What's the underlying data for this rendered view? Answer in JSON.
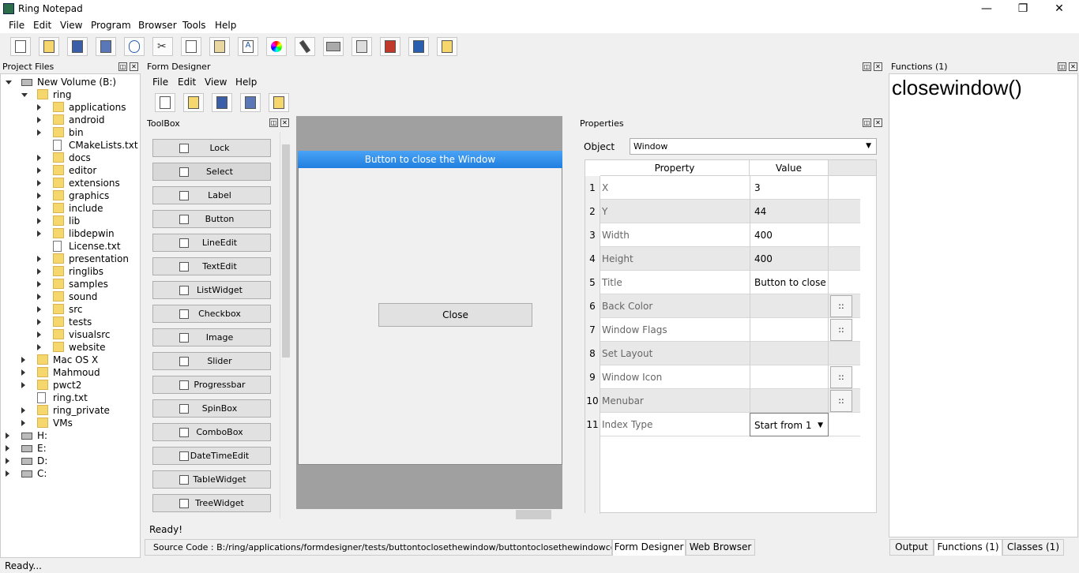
{
  "window": {
    "title": "Ring Notepad",
    "minimize": "—",
    "maximize": "❐",
    "close": "✕"
  },
  "menu": [
    "File",
    "Edit",
    "View",
    "Program",
    "Browser",
    "Tools",
    "Help"
  ],
  "project_files": {
    "title": "Project Files",
    "tree": [
      {
        "label": "New Volume (B:)",
        "kind": "drive",
        "level": 0,
        "expanded": true
      },
      {
        "label": "ring",
        "kind": "folder",
        "level": 1,
        "expanded": true
      },
      {
        "label": "applications",
        "kind": "folder",
        "level": 2
      },
      {
        "label": "android",
        "kind": "folder",
        "level": 2
      },
      {
        "label": "bin",
        "kind": "folder",
        "level": 2
      },
      {
        "label": "CMakeLists.txt",
        "kind": "file",
        "level": 2
      },
      {
        "label": "docs",
        "kind": "folder",
        "level": 2
      },
      {
        "label": "editor",
        "kind": "folder",
        "level": 2
      },
      {
        "label": "extensions",
        "kind": "folder",
        "level": 2
      },
      {
        "label": "graphics",
        "kind": "folder",
        "level": 2
      },
      {
        "label": "include",
        "kind": "folder",
        "level": 2
      },
      {
        "label": "lib",
        "kind": "folder",
        "level": 2
      },
      {
        "label": "libdepwin",
        "kind": "folder",
        "level": 2
      },
      {
        "label": "License.txt",
        "kind": "file",
        "level": 2
      },
      {
        "label": "presentation",
        "kind": "folder",
        "level": 2
      },
      {
        "label": "ringlibs",
        "kind": "folder",
        "level": 2
      },
      {
        "label": "samples",
        "kind": "folder",
        "level": 2
      },
      {
        "label": "sound",
        "kind": "folder",
        "level": 2
      },
      {
        "label": "src",
        "kind": "folder",
        "level": 2
      },
      {
        "label": "tests",
        "kind": "folder",
        "level": 2
      },
      {
        "label": "visualsrc",
        "kind": "folder",
        "level": 2
      },
      {
        "label": "website",
        "kind": "folder",
        "level": 2
      },
      {
        "label": "Mac OS X",
        "kind": "folder",
        "level": 1
      },
      {
        "label": "Mahmoud",
        "kind": "folder",
        "level": 1
      },
      {
        "label": "pwct2",
        "kind": "folder",
        "level": 1
      },
      {
        "label": "ring.txt",
        "kind": "file",
        "level": 1
      },
      {
        "label": "ring_private",
        "kind": "folder",
        "level": 1
      },
      {
        "label": "VMs",
        "kind": "folder",
        "level": 1
      },
      {
        "label": "H:",
        "kind": "drive",
        "level": 0
      },
      {
        "label": "E:",
        "kind": "drive",
        "level": 0
      },
      {
        "label": "D:",
        "kind": "drive",
        "level": 0
      },
      {
        "label": "C:",
        "kind": "drive",
        "level": 0
      }
    ]
  },
  "form_designer": {
    "title": "Form Designer",
    "menu": [
      "File",
      "Edit",
      "View",
      "Help"
    ],
    "toolbox": {
      "title": "ToolBox",
      "items": [
        "Lock",
        "Select",
        "Label",
        "Button",
        "LineEdit",
        "TextEdit",
        "ListWidget",
        "Checkbox",
        "Image",
        "Slider",
        "Progressbar",
        "SpinBox",
        "ComboBox",
        "DateTimeEdit",
        "TableWidget",
        "TreeWidget"
      ]
    },
    "form": {
      "title": "Button to close the Window",
      "button_label": "Close"
    },
    "status": "Ready!"
  },
  "properties": {
    "title": "Properties",
    "object_label": "Object",
    "object_value": "Window",
    "headers": {
      "property": "Property",
      "value": "Value"
    },
    "rows": [
      {
        "n": "1",
        "key": "X",
        "value": "3",
        "dots": ""
      },
      {
        "n": "2",
        "key": "Y",
        "value": "44",
        "dots": ""
      },
      {
        "n": "3",
        "key": "Width",
        "value": "400",
        "dots": ""
      },
      {
        "n": "4",
        "key": "Height",
        "value": "400",
        "dots": ""
      },
      {
        "n": "5",
        "key": "Title",
        "value": "Button to close ...",
        "dots": ""
      },
      {
        "n": "6",
        "key": "Back Color",
        "value": "",
        "dots": "::"
      },
      {
        "n": "7",
        "key": "Window Flags",
        "value": "",
        "dots": "::"
      },
      {
        "n": "8",
        "key": "Set Layout",
        "value": "",
        "dots": ""
      },
      {
        "n": "9",
        "key": "Window Icon",
        "value": "",
        "dots": "::"
      },
      {
        "n": "10",
        "key": "Menubar",
        "value": "",
        "dots": "::"
      },
      {
        "n": "11",
        "key": "Index Type",
        "value": "Start from 1",
        "dots": ""
      }
    ]
  },
  "functions": {
    "title": "Functions (1)",
    "content": "closewindow()"
  },
  "bottom_tabs": {
    "source": "Source Code : B:/ring/applications/formdesigner/tests/buttontoclosethewindow/buttontoclosethewindowcontroller.ring",
    "form_designer": "Form Designer",
    "web_browser": "Web Browser",
    "output": "Output",
    "functions": "Functions (1)",
    "classes": "Classes (1)"
  },
  "status": "Ready..."
}
